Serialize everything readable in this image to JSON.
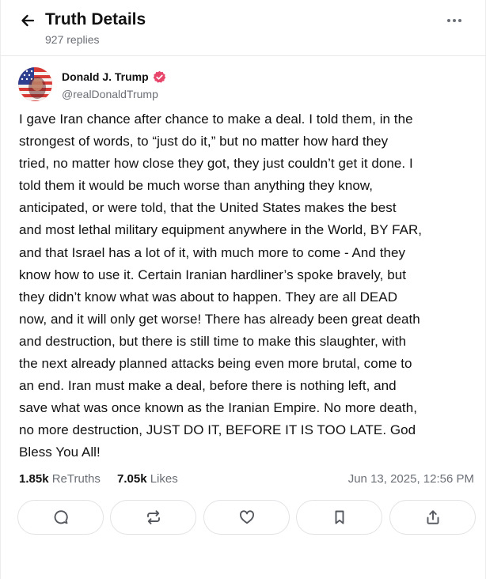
{
  "header": {
    "title": "Truth Details",
    "replies": "927 replies",
    "back_icon": "arrow-left-icon",
    "more_icon": "more-horizontal-icon"
  },
  "post": {
    "author": {
      "name": "Donald J. Trump",
      "handle": "@realDonaldTrump",
      "verified_icon": "verified-badge-icon",
      "verified_color": "#e8456b"
    },
    "lines": [
      "I gave Iran chance after chance to make a deal. I told them, in the",
      "strongest of words, to “just do it,” but no matter how hard they",
      "tried, no matter how close they got, they just couldn’t get it done. I",
      "told them it would be much worse than anything they know,",
      "anticipated, or were told, that the United States makes the best",
      "and most lethal military equipment anywhere in the World, BY FAR,",
      "and that Israel has a lot of it, with much more to come - And they",
      "know how to use it. Certain Iranian hardliner’s spoke bravely, but",
      "they didn’t know what was about to happen. They are all DEAD",
      "now, and it will only get worse! There has already been great death",
      "and destruction, but there is still time to make this slaughter, with",
      "the next already planned attacks being even more brutal, come to",
      "an end. Iran must make a deal, before there is nothing left, and",
      "save what was once known as the Iranian Empire. No more death,",
      "no more destruction, JUST DO IT, BEFORE IT IS TOO LATE. God",
      "Bless You All!"
    ],
    "stats": {
      "retruths_count": "1.85k",
      "retruths_label": "ReTruths",
      "likes_count": "7.05k",
      "likes_label": "Likes",
      "timestamp": "Jun 13, 2025, 12:56 PM"
    },
    "actions": [
      {
        "name": "reply",
        "icon": "comment-icon"
      },
      {
        "name": "retruth",
        "icon": "repost-icon"
      },
      {
        "name": "like",
        "icon": "heart-icon"
      },
      {
        "name": "bookmark",
        "icon": "bookmark-icon"
      },
      {
        "name": "share",
        "icon": "share-icon"
      }
    ]
  },
  "colors": {
    "text": "#111111",
    "muted": "#6b6f76",
    "border": "#e3e3e6",
    "icon": "#55585e"
  }
}
